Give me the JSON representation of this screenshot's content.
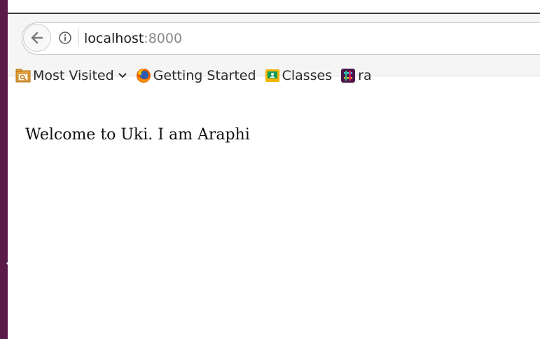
{
  "browser": {
    "url_host": "localhost",
    "url_port": ":8000",
    "bookmarks": [
      {
        "label": "Most Visited",
        "icon": "folder-icon"
      },
      {
        "label": "Getting Started",
        "icon": "firefox-icon"
      },
      {
        "label": "Classes",
        "icon": "classroom-icon"
      },
      {
        "label": "ra",
        "icon": "slack-icon"
      }
    ]
  },
  "page": {
    "body_text": "Welcome to Uki. I am Araphi"
  },
  "colors": {
    "desktop_strip": "#5a1a4a",
    "toolbar_bg": "#f5f5f5"
  }
}
